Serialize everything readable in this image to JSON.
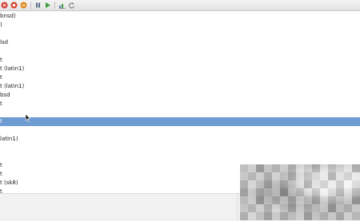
{
  "toolbar": {
    "buttons": [
      {
        "icon": "close-circle-icon",
        "color": "#d13b2f"
      },
      {
        "icon": "stop-circle-icon",
        "color": "#d6452b"
      },
      {
        "icon": "minus-circle-icon",
        "color": "#e08a1e"
      },
      {
        "icon": "pause-icon",
        "color": "#5a6e8c"
      },
      {
        "icon": "play-icon",
        "color": "#3b9d3b"
      },
      {
        "icon": "chart-icon",
        "color": "#4a7bb3"
      },
      {
        "icon": "refresh-icon",
        "color": "#7a7a7a"
      }
    ]
  },
  "list": {
    "selected_index": 12,
    "selection_color": "#6e9bd2",
    "rows": [
      "bnsd)",
      ")",
      "",
      "lsd",
      "",
      "t",
      "t (latin1)",
      "t",
      "t (latin1)",
      "bsd",
      "t",
      "",
      "t",
      "",
      "latin1)",
      "",
      "",
      "t",
      "t",
      "t (sk8)",
      "t"
    ]
  }
}
